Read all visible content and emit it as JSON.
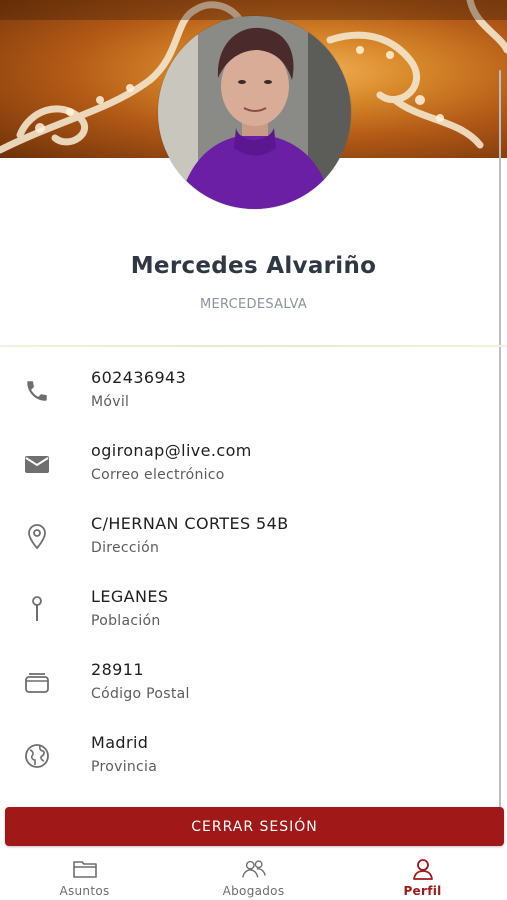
{
  "profile": {
    "name": "Mercedes Alvariño",
    "username": "MERCEDESALVA"
  },
  "info": [
    {
      "icon": "phone-icon",
      "value": "602436943",
      "label": "Móvil"
    },
    {
      "icon": "mail-icon",
      "value": "ogironap@live.com",
      "label": "Correo electrónico"
    },
    {
      "icon": "location-pin-icon",
      "value": "C/HERNAN CORTES 54B",
      "label": "Dirección"
    },
    {
      "icon": "map-pin-icon",
      "value": "LEGANES",
      "label": "Población"
    },
    {
      "icon": "postal-box-icon",
      "value": "28911",
      "label": "Código Postal"
    },
    {
      "icon": "globe-icon",
      "value": "Madrid",
      "label": "Provincia"
    }
  ],
  "actions": {
    "logout_label": "CERRAR SESIÓN"
  },
  "nav": {
    "items": [
      {
        "icon": "folder-icon",
        "label": "Asuntos",
        "active": false
      },
      {
        "icon": "people-icon",
        "label": "Abogados",
        "active": false
      },
      {
        "icon": "person-icon",
        "label": "Perfil",
        "active": true
      }
    ]
  },
  "colors": {
    "accent": "#a01818",
    "icon_gray": "#6f6f6f",
    "name_text": "#2f3742",
    "username_text": "#8c93a1"
  }
}
